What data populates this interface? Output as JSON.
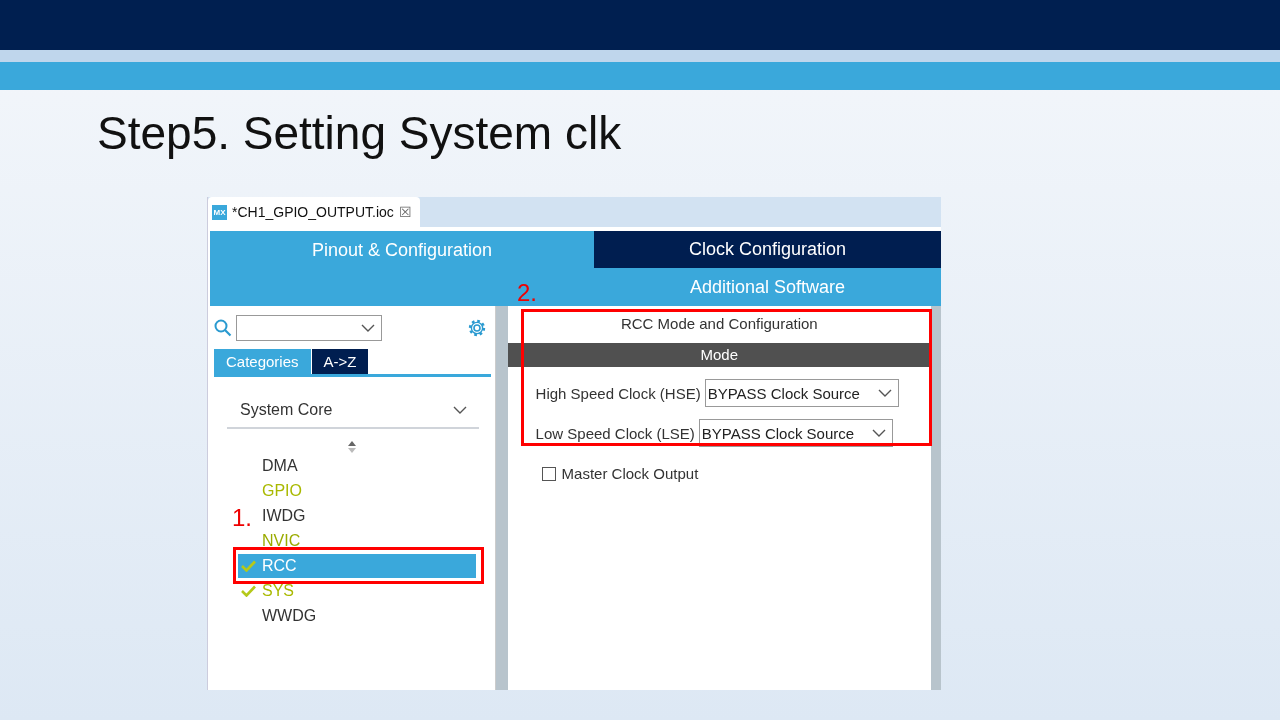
{
  "slide_title": "Step5. Setting System clk",
  "file_tab": {
    "icon_text": "MX",
    "title": "*CH1_GPIO_OUTPUT.ioc",
    "close": "☒"
  },
  "tabs": [
    {
      "label": "Pinout & Configuration",
      "selected": true
    },
    {
      "label": "Clock Configuration",
      "selected": false
    }
  ],
  "subbar": {
    "label": "Additional Software"
  },
  "sidebar": {
    "view_tabs": [
      {
        "label": "Categories",
        "selected": true
      },
      {
        "label": "A->Z",
        "selected": false
      }
    ],
    "category": "System Core",
    "items": [
      {
        "label": "DMA",
        "color": "#333333",
        "checked": false,
        "selected": false
      },
      {
        "label": "GPIO",
        "color": "#a9b900",
        "checked": false,
        "selected": false
      },
      {
        "label": "IWDG",
        "color": "#333333",
        "checked": false,
        "selected": false
      },
      {
        "label": "NVIC",
        "color": "#9aab00",
        "checked": false,
        "selected": false
      },
      {
        "label": "RCC",
        "color": "#ffffff",
        "checked": true,
        "selected": true
      },
      {
        "label": "SYS",
        "color": "#a9b900",
        "checked": true,
        "selected": false
      },
      {
        "label": "WWDG",
        "color": "#333333",
        "checked": false,
        "selected": false
      }
    ]
  },
  "panel": {
    "title": "RCC Mode and Configuration",
    "section": "Mode",
    "fields": [
      {
        "label": "High Speed Clock (HSE)",
        "value": "BYPASS Clock Source"
      },
      {
        "label": "Low Speed Clock (LSE)",
        "value": "BYPASS Clock Source"
      }
    ],
    "checkbox": {
      "label": "Master Clock Output",
      "checked": false
    }
  },
  "annotations": [
    {
      "label": "1."
    },
    {
      "label": "2."
    }
  ]
}
